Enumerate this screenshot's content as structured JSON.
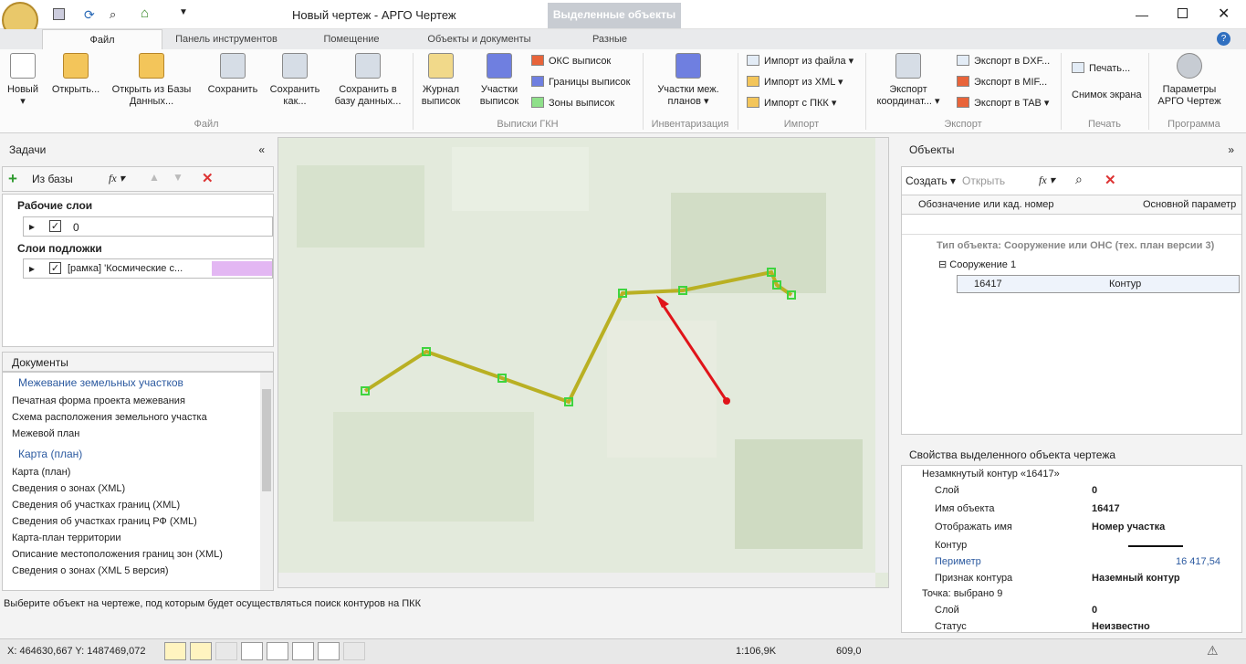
{
  "app": {
    "title": "Новый чертеж - АРГО Чертеж",
    "context_tab": "Выделенные объекты"
  },
  "tabs": [
    "Файл",
    "Панель инструментов",
    "Помещение",
    "Объекты и документы",
    "Разные"
  ],
  "ribbon": {
    "file": {
      "new": "Новый",
      "open": "Открыть...",
      "open_db": "Открыть из Базы Данных...",
      "save": "Сохранить",
      "save_as": "Сохранить как...",
      "save_db": "Сохранить в базу данных...",
      "group": "Файл"
    },
    "gkn": {
      "journal": "Журнал выписок",
      "parcels": "Участки выписок",
      "oks": "ОКС выписок",
      "bounds": "Границы выписок",
      "zones": "Зоны выписок",
      "group": "Выписки ГКН"
    },
    "inv": {
      "plans": "Участки меж. планов",
      "group": "Инвентаризация"
    },
    "import": {
      "file": "Импорт из файла",
      "xml": "Импорт из XML",
      "pkk": "Импорт с ПКК",
      "group": "Импорт"
    },
    "export": {
      "coords": "Экспорт координат...",
      "dxf": "Экспорт в DXF...",
      "mif": "Экспорт в MIF...",
      "tab": "Экспорт в TAB",
      "group": "Экспорт"
    },
    "print": {
      "print": "Печать...",
      "screen": "Снимок экрана",
      "group": "Печать"
    },
    "program": {
      "params": "Параметры АРГО Чертеж",
      "group": "Программа"
    }
  },
  "tasks": {
    "title": "Задачи",
    "from_db": "Из базы",
    "fx": "fx",
    "work_layers": "Рабочие слои",
    "layer0": "0",
    "base_layers": "Слои подложки",
    "base_item": "[рамка] 'Космические с..."
  },
  "documents": {
    "title": "Документы",
    "groups": [
      {
        "name": "Межевание земельных участков",
        "items": [
          "Печатная форма проекта межевания",
          "Схема расположения земельного участка",
          "Межевой план"
        ]
      },
      {
        "name": "Карта (план)",
        "items": [
          "Карта (план)",
          "Сведения о зонах (XML)",
          "Сведения об участках границ (XML)",
          "Сведения об участках границ РФ (XML)",
          "Карта-план территории",
          "Описание местоположения границ зон (XML)",
          "Сведения о зонах (XML 5 версия)"
        ]
      }
    ]
  },
  "objects": {
    "title": "Объекты",
    "create": "Создать",
    "open": "Открыть",
    "col1": "Обозначение или кад. номер",
    "col2": "Основной параметр",
    "group_row": "Тип объекта: Сооружение или ОНС (тех. план версии 3)",
    "structure": "Сооружение 1",
    "row_id": "16417",
    "row_param": "Контур"
  },
  "props": {
    "title": "Свойства выделенного объекта чертежа",
    "sec1": "Незамкнутый контур «16417»",
    "rows": [
      [
        "Слой",
        "0"
      ],
      [
        "Имя объекта",
        "16417"
      ],
      [
        "Отображать имя",
        "Номер участка"
      ],
      [
        "Контур",
        ""
      ],
      [
        "Периметр",
        "16 417,54"
      ],
      [
        "Признак контура",
        "Наземный контур"
      ]
    ],
    "sec2": "Точка: выбрано 9",
    "rows2": [
      [
        "Слой",
        "0"
      ],
      [
        "Статус",
        "Неизвестно"
      ]
    ]
  },
  "hint": "Выберите объект на чертеже, под которым будет осуществляться поиск контуров на ПКК",
  "status": {
    "coords": "X: 464630,667 Y: 1487469,072",
    "scale": "1:106,9K",
    "value": "609,0"
  }
}
